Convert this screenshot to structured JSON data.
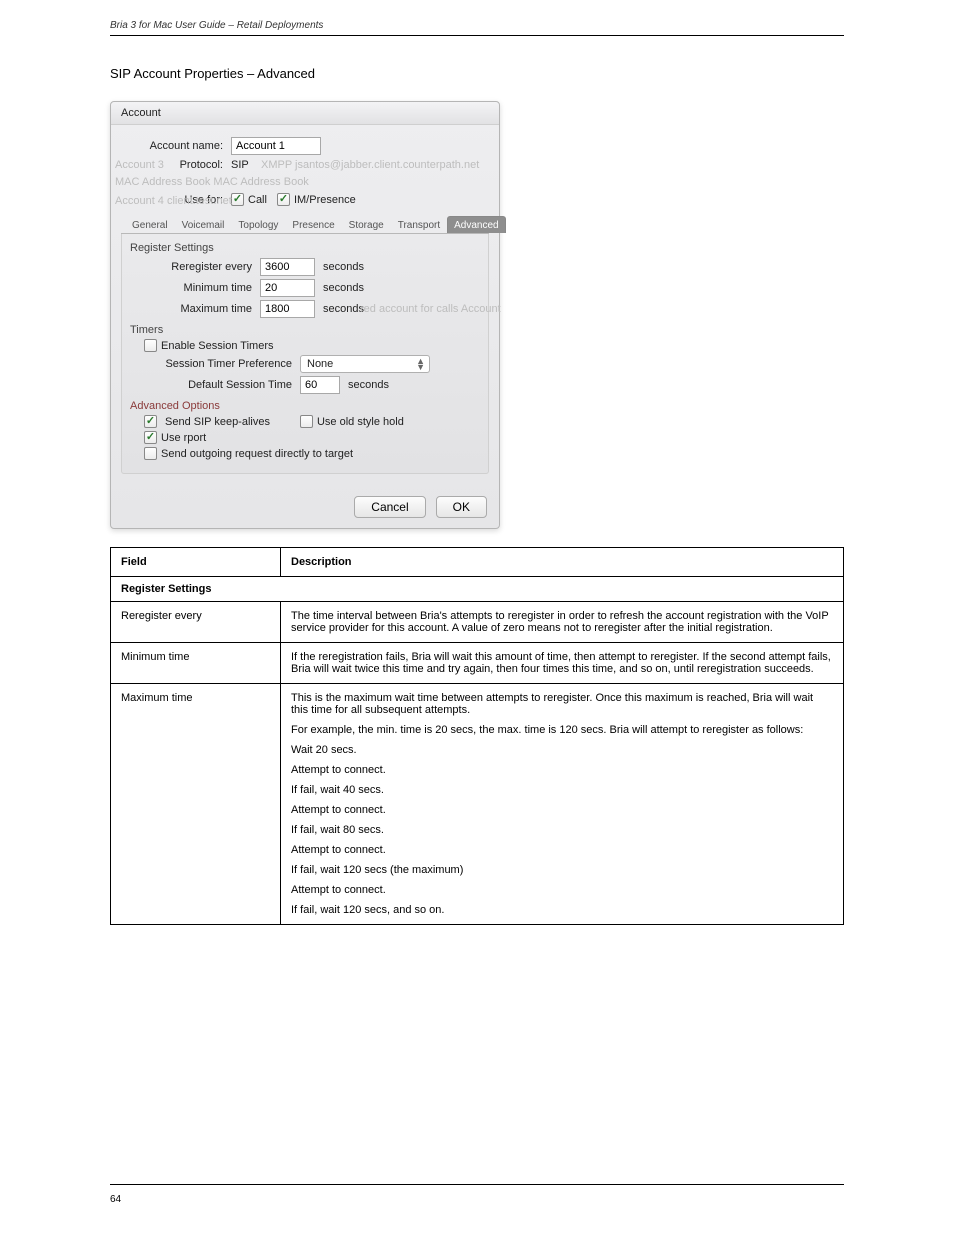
{
  "header": {
    "left": "Bria 3 for Mac User Guide – Retail Deployments",
    "right": ""
  },
  "page_number": "64",
  "section_title": "SIP Account Properties – Advanced",
  "dialog": {
    "title": "Account",
    "account_name_label": "Account name:",
    "account_name_value": "Account 1",
    "protocol_label": "Protocol:",
    "protocol_value": "SIP",
    "use_for_label": "Use for:",
    "use_for": {
      "call": "Call",
      "im": "IM/Presence"
    },
    "ghost_left": "Account 3",
    "ghost_right": "XMPP   jsantos@jabber.client.counterpath.net",
    "ghost_line2": "MAC Address Book                       MAC Address Book",
    "ghost_line3": "Account 4                                          client.test.net",
    "tabs": [
      "General",
      "Voicemail",
      "Topology",
      "Presence",
      "Storage",
      "Transport",
      "Advanced"
    ],
    "register_settings_label": "Register Settings",
    "reregister_label": "Reregister every",
    "reregister_value": "3600",
    "reregister_unit": "seconds",
    "min_label": "Minimum time",
    "min_value": "20",
    "min_unit": "seconds",
    "max_label": "Maximum time",
    "max_value": "1800",
    "max_unit": "seconds",
    "ghost_proxy": "red account for calls    Account",
    "timers_label": "Timers",
    "enable_timers_label": "Enable Session Timers",
    "stp_label": "Session Timer Preference",
    "stp_value": "None",
    "dst_label": "Default Session Time",
    "dst_value": "60",
    "dst_unit": "seconds",
    "adv_label": "Advanced Options",
    "keepalives": "Send SIP keep-alives",
    "oldhold": "Use old style hold",
    "rport": "Use rport",
    "direct": "Send outgoing request directly to target",
    "cancel": "Cancel",
    "ok": "OK"
  },
  "table": {
    "col_field": "Field",
    "col_desc": "Description",
    "sect_register": "Register Settings",
    "rows": [
      {
        "field": "Reregister every",
        "desc": [
          "The time interval between Bria's attempts to reregister in order to refresh the account registration with the VoIP service provider for this account. A value of zero means not to reregister after the initial registration."
        ]
      },
      {
        "field": "Minimum time",
        "desc": [
          "If the reregistration fails, Bria will wait this amount of time, then attempt to reregister. If the second attempt fails, Bria will wait twice this time and try again, then four times this time, and so on, until reregistration succeeds."
        ]
      },
      {
        "field": "Maximum time",
        "desc": [
          "This is the maximum wait time between attempts to reregister. Once this maximum is reached, Bria will wait this time for all subsequent attempts.",
          "For example, the min. time is 20 secs, the max. time is 120 secs. Bria will attempt to reregister as follows:",
          "Wait 20 secs.",
          "Attempt to connect.",
          "If fail, wait 40 secs.",
          "Attempt to connect.",
          "If fail, wait 80 secs.",
          "Attempt to connect.",
          "If fail, wait 120 secs (the maximum)",
          "Attempt to connect.",
          "If fail, wait 120 secs, and so on."
        ]
      }
    ]
  }
}
